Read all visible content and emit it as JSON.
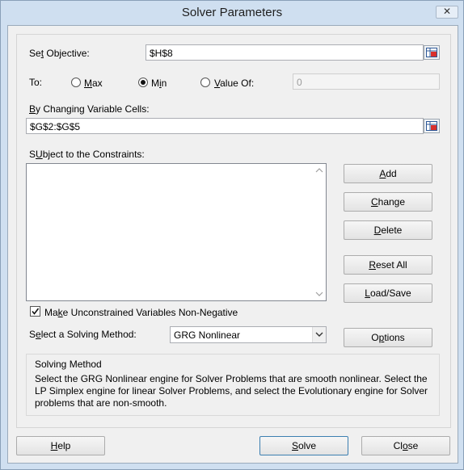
{
  "window": {
    "title": "Solver Parameters",
    "close_icon": "close-icon"
  },
  "objective": {
    "label_pre": "Se",
    "label_u": "t",
    "label_post": " Objective:",
    "value": "$H$8"
  },
  "to": {
    "label": "To:",
    "options": [
      {
        "pre": "",
        "u": "M",
        "post": "ax",
        "checked": false
      },
      {
        "pre": "M",
        "u": "i",
        "post": "n",
        "checked": true
      },
      {
        "pre": "",
        "u": "V",
        "post": "alue Of:",
        "checked": false
      }
    ],
    "value_of": "0"
  },
  "changing": {
    "label_u": "B",
    "label_post": "y Changing Variable Cells:",
    "value": "$G$2:$G$5"
  },
  "constraints": {
    "label_u": "U",
    "label_post": "Subject to the Constraints:",
    "items": []
  },
  "side_buttons": {
    "add": {
      "pre": "",
      "u": "A",
      "post": "dd"
    },
    "change": {
      "pre": "",
      "u": "C",
      "post": "hange"
    },
    "delete": {
      "pre": "",
      "u": "D",
      "post": "elete"
    },
    "reset": {
      "pre": "",
      "u": "R",
      "post": "eset All"
    },
    "load": {
      "pre": "",
      "u": "L",
      "post": "oad/Save"
    },
    "options": {
      "pre": "O",
      "u": "p",
      "post": "tions"
    }
  },
  "nonneg": {
    "checked": true,
    "pre": "Ma",
    "u": "k",
    "post": "e Unconstrained Variables Non-Negative"
  },
  "method": {
    "label_pre": "S",
    "label_u": "e",
    "label_post": "lect a Solving Method:",
    "selected": "GRG Nonlinear"
  },
  "solving_method": {
    "title": "Solving Method",
    "text": "Select the GRG Nonlinear engine for Solver Problems that are smooth nonlinear. Select the LP Simplex engine for linear Solver Problems, and select the Evolutionary engine for Solver problems that are non-smooth."
  },
  "footer": {
    "help": {
      "pre": "",
      "u": "H",
      "post": "elp"
    },
    "solve": {
      "pre": "",
      "u": "S",
      "post": "olve"
    },
    "close": {
      "pre": "Cl",
      "u": "o",
      "post": "se"
    }
  }
}
